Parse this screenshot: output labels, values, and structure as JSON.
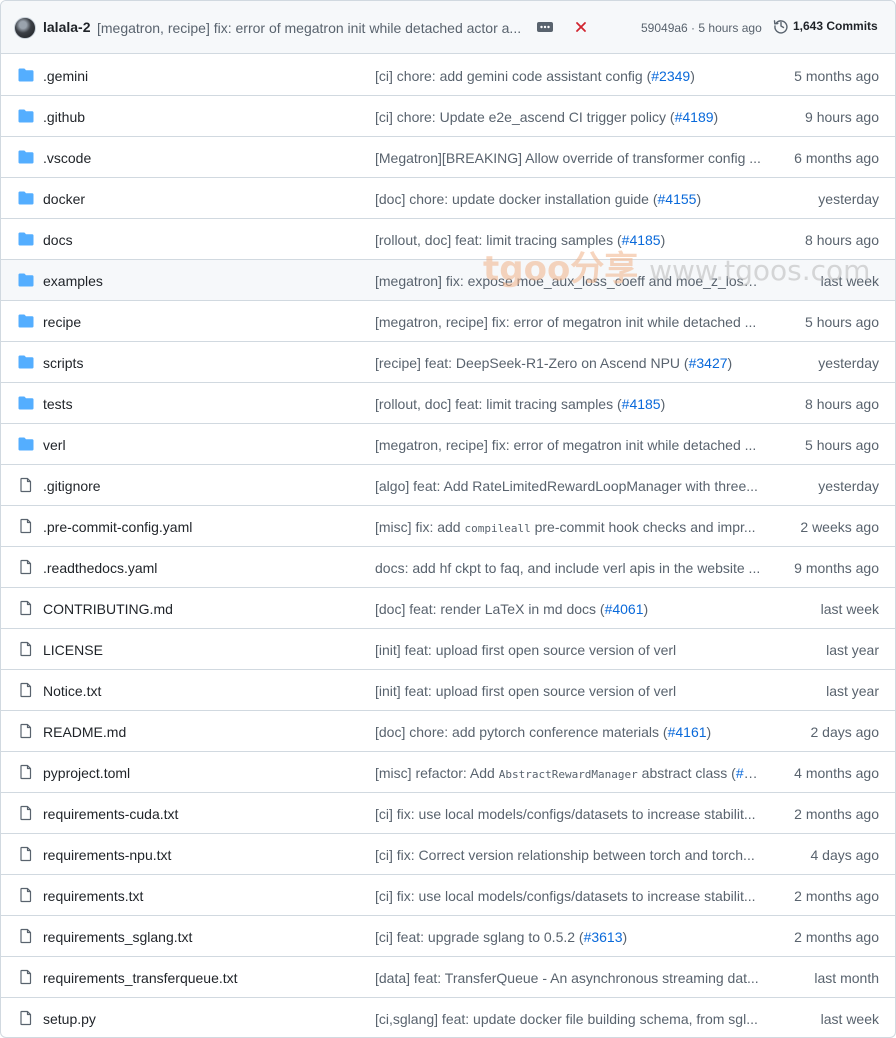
{
  "header": {
    "author": "lalala-2",
    "commit_message": "[megatron, recipe] fix: error of megatron init while detached actor a...",
    "sha_time": "59049a6 · 5 hours ago",
    "commits_label": "1,643 Commits",
    "status_color": "#d1242f"
  },
  "watermark": {
    "brand": "tgoo分享",
    "url": "www.tgoos.com"
  },
  "files": [
    {
      "type": "dir",
      "name": ".gemini",
      "msg": "[ci] chore: add gemini code assistant config (",
      "link": "#2349",
      "tail": ")",
      "age": "5 months ago"
    },
    {
      "type": "dir",
      "name": ".github",
      "msg": "[ci] chore: Update e2e_ascend CI trigger policy (",
      "link": "#4189",
      "tail": ")",
      "age": "9 hours ago"
    },
    {
      "type": "dir",
      "name": ".vscode",
      "msg": "[Megatron][BREAKING] Allow override of transformer config ...",
      "link": "",
      "tail": "",
      "age": "6 months ago"
    },
    {
      "type": "dir",
      "name": "docker",
      "msg": "[doc] chore: update docker installation guide (",
      "link": "#4155",
      "tail": ")",
      "age": "yesterday"
    },
    {
      "type": "dir",
      "name": "docs",
      "msg": "[rollout, doc] feat: limit tracing samples (",
      "link": "#4185",
      "tail": ")",
      "age": "8 hours ago"
    },
    {
      "type": "dir",
      "name": "examples",
      "msg": "[megatron] fix: expose moe_aux_loss_coeff and moe_z_loss_c...",
      "link": "",
      "tail": "",
      "age": "last week",
      "hl": true
    },
    {
      "type": "dir",
      "name": "recipe",
      "msg": "[megatron, recipe] fix: error of megatron init while detached ...",
      "link": "",
      "tail": "",
      "age": "5 hours ago"
    },
    {
      "type": "dir",
      "name": "scripts",
      "msg": "[recipe] feat: DeepSeek-R1-Zero on Ascend NPU (",
      "link": "#3427",
      "tail": ")",
      "age": "yesterday"
    },
    {
      "type": "dir",
      "name": "tests",
      "msg": "[rollout, doc] feat: limit tracing samples (",
      "link": "#4185",
      "tail": ")",
      "age": "8 hours ago"
    },
    {
      "type": "dir",
      "name": "verl",
      "msg": "[megatron, recipe] fix: error of megatron init while detached ...",
      "link": "",
      "tail": "",
      "age": "5 hours ago"
    },
    {
      "type": "file",
      "name": ".gitignore",
      "msg": "[algo] feat: Add RateLimitedRewardLoopManager with three...",
      "link": "",
      "tail": "",
      "age": "yesterday"
    },
    {
      "type": "file",
      "name": ".pre-commit-config.yaml",
      "msg": "[misc] fix: add ",
      "code": "compileall",
      "msg2": " pre-commit hook checks and impr...",
      "link": "",
      "tail": "",
      "age": "2 weeks ago"
    },
    {
      "type": "file",
      "name": ".readthedocs.yaml",
      "msg": "docs: add hf ckpt to faq, and include verl apis in the website ...",
      "link": "",
      "tail": "",
      "age": "9 months ago"
    },
    {
      "type": "file",
      "name": "CONTRIBUTING.md",
      "msg": "[doc] feat: render LaTeX in md docs (",
      "link": "#4061",
      "tail": ")",
      "age": "last week"
    },
    {
      "type": "file",
      "name": "LICENSE",
      "msg": "[init] feat: upload first open source version of verl",
      "link": "",
      "tail": "",
      "age": "last year"
    },
    {
      "type": "file",
      "name": "Notice.txt",
      "msg": "[init] feat: upload first open source version of verl",
      "link": "",
      "tail": "",
      "age": "last year"
    },
    {
      "type": "file",
      "name": "README.md",
      "msg": "[doc] chore: add pytorch conference materials (",
      "link": "#4161",
      "tail": ")",
      "age": "2 days ago"
    },
    {
      "type": "file",
      "name": "pyproject.toml",
      "msg": "[misc] refactor: Add ",
      "code": "AbstractRewardManager",
      "msg2": " abstract class (",
      "link": "#2...",
      "tail": "",
      "age": "4 months ago"
    },
    {
      "type": "file",
      "name": "requirements-cuda.txt",
      "msg": "[ci] fix: use local models/configs/datasets to increase stabilit...",
      "link": "",
      "tail": "",
      "age": "2 months ago"
    },
    {
      "type": "file",
      "name": "requirements-npu.txt",
      "msg": "[ci] fix: Correct version relationship between torch and torch...",
      "link": "",
      "tail": "",
      "age": "4 days ago"
    },
    {
      "type": "file",
      "name": "requirements.txt",
      "msg": "[ci] fix: use local models/configs/datasets to increase stabilit...",
      "link": "",
      "tail": "",
      "age": "2 months ago"
    },
    {
      "type": "file",
      "name": "requirements_sglang.txt",
      "msg": "[ci] feat: upgrade sglang to 0.5.2 (",
      "link": "#3613",
      "tail": ")",
      "age": "2 months ago"
    },
    {
      "type": "file",
      "name": "requirements_transferqueue.txt",
      "msg": "[data] feat: TransferQueue - An asynchronous streaming dat...",
      "link": "",
      "tail": "",
      "age": "last month"
    },
    {
      "type": "file",
      "name": "setup.py",
      "msg": "[ci,sglang] feat: update docker file building schema, from sgl...",
      "link": "",
      "tail": "",
      "age": "last week"
    }
  ]
}
